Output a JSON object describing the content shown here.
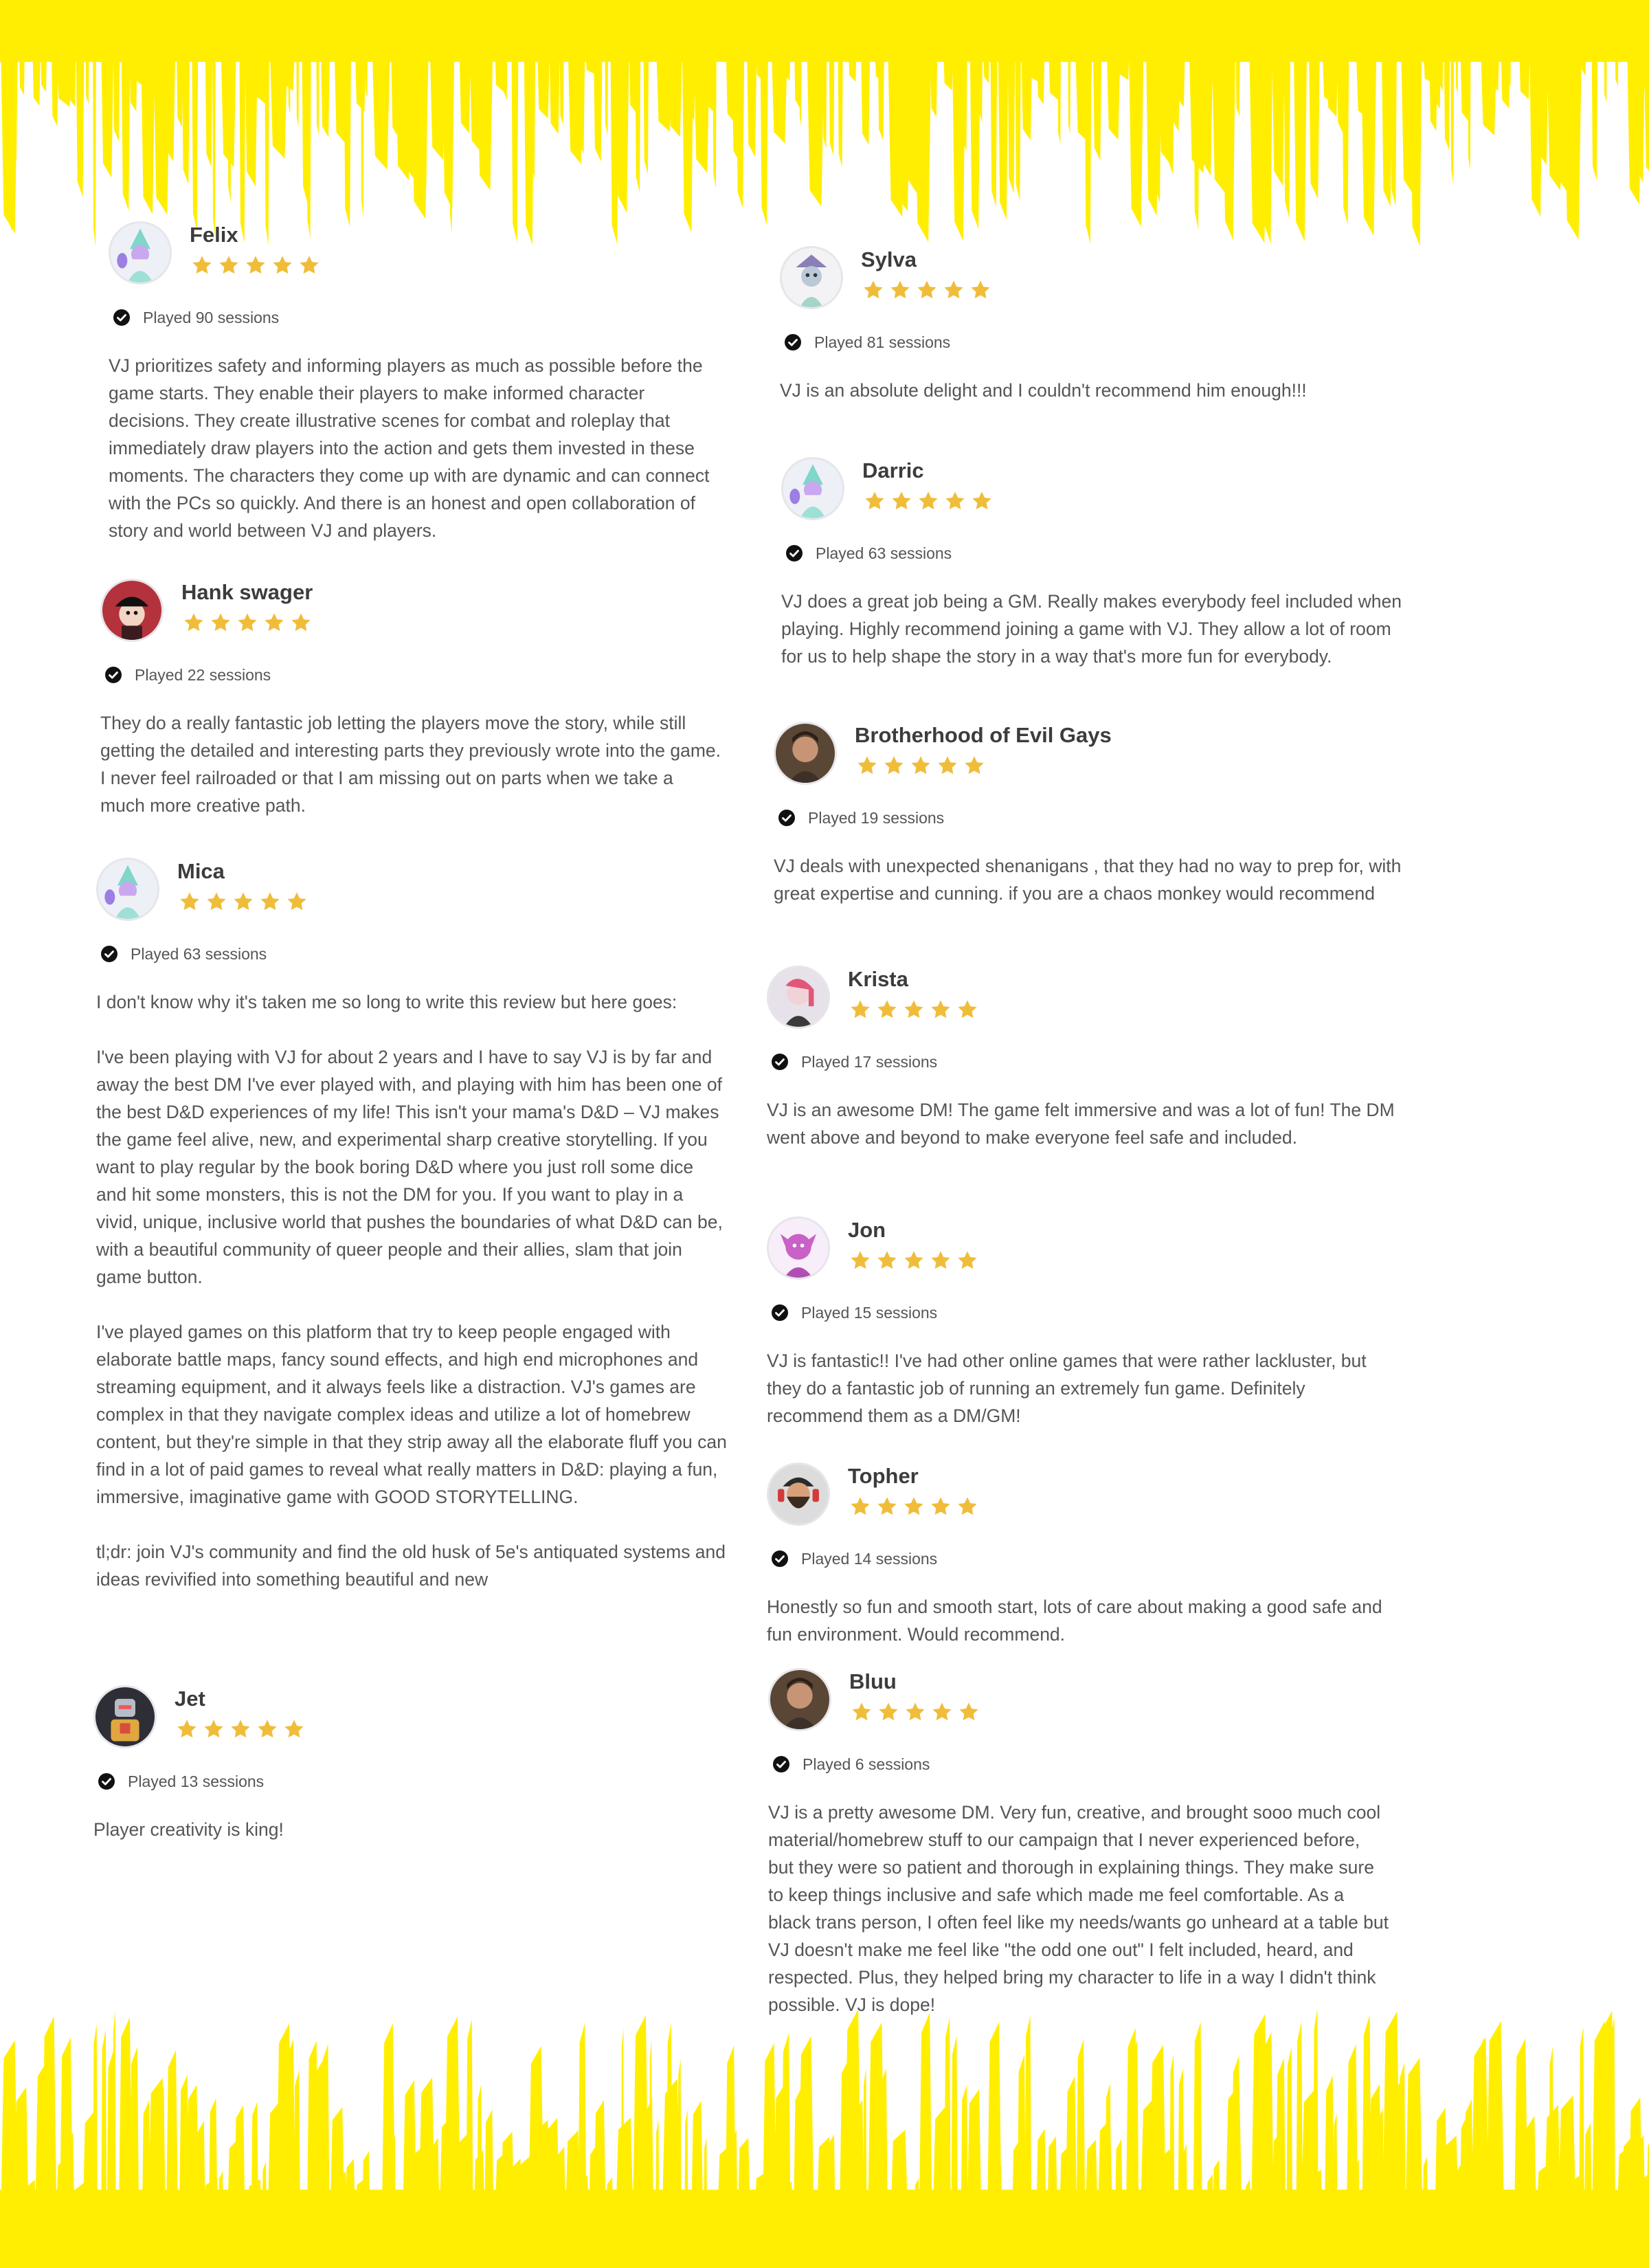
{
  "colors": {
    "accent_yellow": "#ffee00",
    "star": "#f0bd3a",
    "check": "#111111"
  },
  "icons": {
    "star": "star-icon",
    "verified": "verified-check-icon"
  },
  "reviews": [
    {
      "id": "felix",
      "name": "Felix",
      "rating": 5,
      "played": "Played 90 sessions",
      "avatar": "wizard-avatar",
      "text": [
        "VJ prioritizes safety and informing players as much as possible before the game starts. They enable their players to make informed character decisions. They create illustrative scenes for combat and roleplay that immediately draw players into the action and gets them invested in these moments. The characters they come up with are dynamic and can connect with the PCs so quickly. And there is an honest and open collaboration of story and world between VJ and players."
      ]
    },
    {
      "id": "hank",
      "name": "Hank swager",
      "rating": 5,
      "played": "Played 22 sessions",
      "avatar": "pirate-avatar",
      "text": [
        "They do a really fantastic job letting the players move the story, while still getting the detailed and interesting parts they previously wrote into the game. I never feel railroaded or that I am missing out on parts when we take a much more creative path."
      ]
    },
    {
      "id": "mica",
      "name": "Mica",
      "rating": 5,
      "played": "Played 63 sessions",
      "avatar": "wizard-avatar",
      "text": [
        "I don't know why it's taken me so long to write this review but here goes:",
        "I've been playing with VJ for about 2 years and I have to say VJ is by far and away the best DM I've ever played with, and playing with him has been one of the best D&D experiences of my life! This isn't your mama's D&D – VJ makes the game feel alive, new, and experimental sharp creative storytelling. If you want to play regular by the book boring D&D where you just roll some dice and hit some monsters, this is not the DM for you. If you want to play in a vivid, unique, inclusive world that pushes the boundaries of what D&D can be, with a beautiful community of queer people and their allies, slam that join game button.",
        "I've played games on this platform that try to keep people engaged with elaborate battle maps, fancy sound effects, and high end microphones and streaming equipment, and it always feels like a distraction. VJ's games are complex in that they navigate complex ideas and utilize a lot of homebrew content, but they're simple in that they strip away all the elaborate fluff you can find in a lot of paid games to reveal what really matters in D&D: playing a fun, immersive, imaginative game with GOOD STORYTELLING.",
        "tl;dr: join VJ's community and find the old husk of 5e's antiquated systems and ideas revivified into something beautiful and new"
      ]
    },
    {
      "id": "jet",
      "name": "Jet",
      "rating": 5,
      "played": "Played 13 sessions",
      "avatar": "robot-avatar",
      "text": [
        "Player creativity is king!"
      ]
    },
    {
      "id": "sylva",
      "name": "Sylva",
      "rating": 5,
      "played": "Played 81 sessions",
      "avatar": "creature-avatar",
      "text": [
        "VJ is an absolute delight and I couldn't recommend him enough!!!"
      ]
    },
    {
      "id": "darric",
      "name": "Darric",
      "rating": 5,
      "played": "Played 63 sessions",
      "avatar": "wizard-avatar",
      "text": [
        "VJ does a great job being a GM. Really makes everybody feel included when playing. Highly recommend joining a game with VJ. They allow a lot of room for us to help shape the story in a way that's more fun for everybody."
      ]
    },
    {
      "id": "brotherhood",
      "name": "Brotherhood of Evil Gays",
      "rating": 5,
      "played": "Played 19 sessions",
      "avatar": "photo-avatar",
      "text": [
        "VJ deals with unexpected shenanigans , that they had no way to prep for, with great expertise and cunning. if you are a chaos monkey would recommend"
      ]
    },
    {
      "id": "krista",
      "name": "Krista",
      "rating": 5,
      "played": "Played 17 sessions",
      "avatar": "pink-avatar",
      "text": [
        "VJ is an awesome DM! The game felt immersive and was a lot of fun! The DM went above and beyond to make everyone feel safe and included."
      ]
    },
    {
      "id": "jon",
      "name": "Jon",
      "rating": 5,
      "played": "Played 15 sessions",
      "avatar": "monster-avatar",
      "text": [
        "VJ is fantastic!! I've had other online games that were rather lackluster, but they do a fantastic job of running an extremely fun game. Definitely recommend them as a DM/GM!"
      ]
    },
    {
      "id": "topher",
      "name": "Topher",
      "rating": 5,
      "played": "Played 14 sessions",
      "avatar": "bearded-avatar",
      "text": [
        "Honestly so fun and smooth start, lots of care about making a good safe and fun environment. Would recommend."
      ]
    },
    {
      "id": "bluu",
      "name": "Bluu",
      "rating": 5,
      "played": "Played 6 sessions",
      "avatar": "photo-avatar",
      "text": [
        "VJ is a pretty awesome DM. Very fun, creative, and brought sooo much cool material/homebrew stuff to our campaign that I never experienced before, but they were so patient and thorough in explaining things. They make sure to keep things inclusive and safe which made me feel comfortable. As a black trans person, I often feel like my needs/wants go unheard at a table but VJ doesn't make me feel like \"the odd one out\" I felt included, heard, and respected. Plus, they helped bring my character to life in a way I didn't think possible. VJ is dope!"
      ]
    }
  ]
}
